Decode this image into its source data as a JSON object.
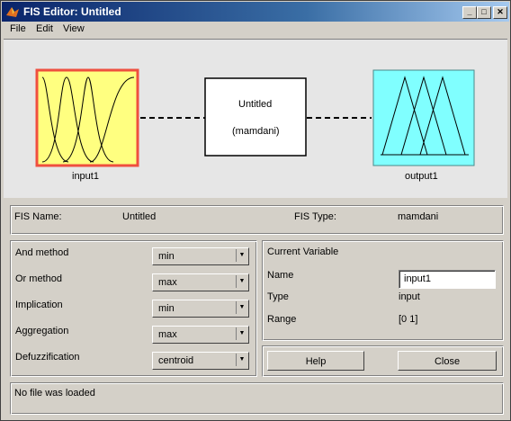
{
  "window": {
    "title": "FIS Editor: Untitled"
  },
  "menu": [
    "File",
    "Edit",
    "View"
  ],
  "diagram": {
    "input_label": "input1",
    "output_label": "output1",
    "system_name": "Untitled",
    "system_type": "(mamdani)",
    "colors": {
      "input_fill": "#ffff80",
      "input_border": "#ef4f3f",
      "output_fill": "#80ffff"
    }
  },
  "fis": {
    "name_label": "FIS Name:",
    "name_value": "Untitled",
    "type_label": "FIS Type:",
    "type_value": "mamdani"
  },
  "methods": [
    {
      "label": "And method",
      "value": "min"
    },
    {
      "label": "Or method",
      "value": "max"
    },
    {
      "label": "Implication",
      "value": "min"
    },
    {
      "label": "Aggregation",
      "value": "max"
    },
    {
      "label": "Defuzzification",
      "value": "centroid"
    }
  ],
  "current_variable": {
    "heading": "Current Variable",
    "name_label": "Name",
    "name_value": "input1",
    "type_label": "Type",
    "type_value": "input",
    "range_label": "Range",
    "range_value": "[0 1]"
  },
  "buttons": {
    "help": "Help",
    "close": "Close"
  },
  "status": "No file was loaded"
}
